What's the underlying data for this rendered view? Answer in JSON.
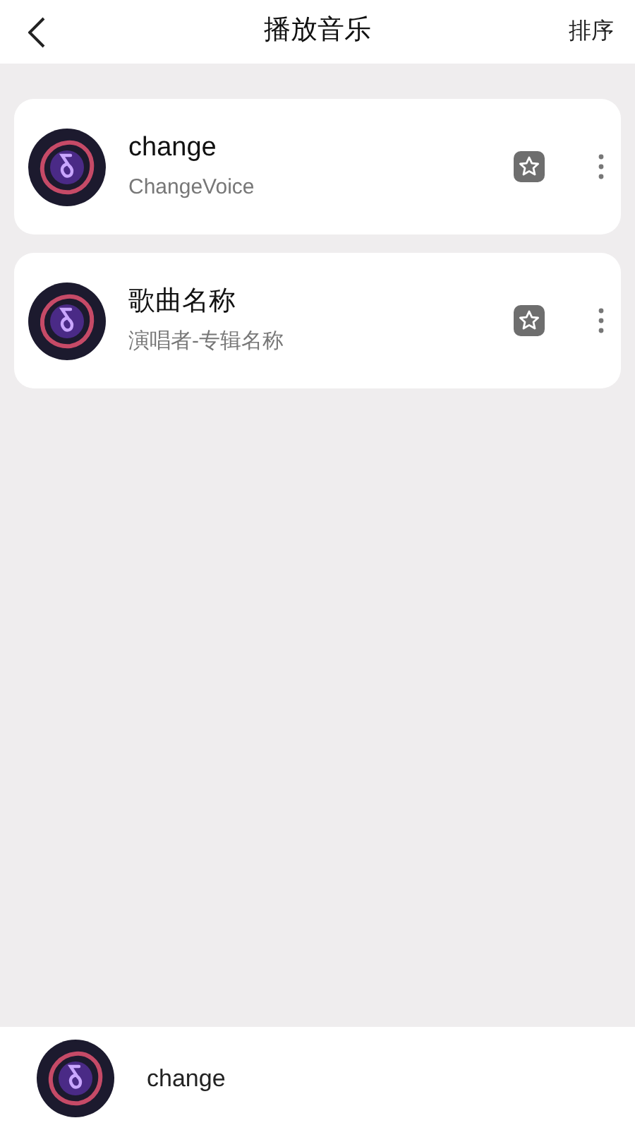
{
  "header": {
    "title": "播放音乐",
    "action": "排序"
  },
  "songs": [
    {
      "title": "change",
      "subtitle": "ChangeVoice"
    },
    {
      "title": "歌曲名称",
      "subtitle": "演唱者-专辑名称"
    }
  ],
  "now_playing": {
    "title": "change"
  }
}
